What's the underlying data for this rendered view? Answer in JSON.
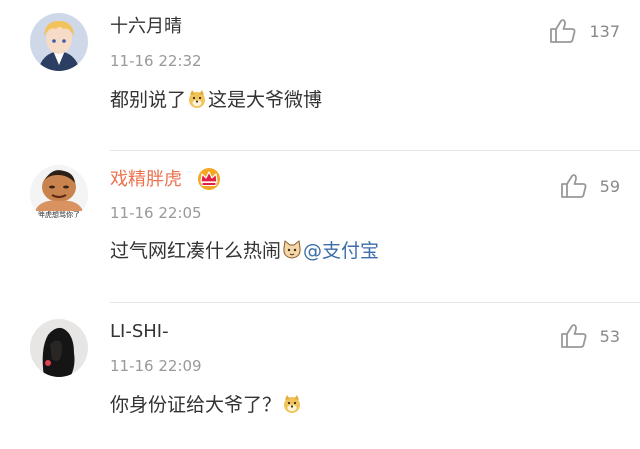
{
  "comments": [
    {
      "username": "十六月晴",
      "time": "11-16 22:32",
      "text_before_emoji": "都别说了",
      "text_after_emoji": "这是大爷微博",
      "emoji": "doge-emoji",
      "likes": "137"
    },
    {
      "username": "戏精胖虎",
      "time": "11-16 22:05",
      "text_before_emoji": "过气网红凑什么热闹",
      "mention": "@支付宝",
      "emoji": "cat-emoji",
      "likes": "59",
      "avatar_caption": "胖虎想骂你了",
      "badge": "crown-badge"
    },
    {
      "username": "LI-SHI-",
      "time": "11-16 22:09",
      "text_before_emoji": "你身份证给大爷了？",
      "emoji": "doge-emoji",
      "likes": "53"
    }
  ],
  "colors": {
    "username_default": "#333333",
    "username_vip": "#eb7350",
    "mention": "#3b6ea8",
    "time": "#999999",
    "like_icon": "#888888"
  }
}
